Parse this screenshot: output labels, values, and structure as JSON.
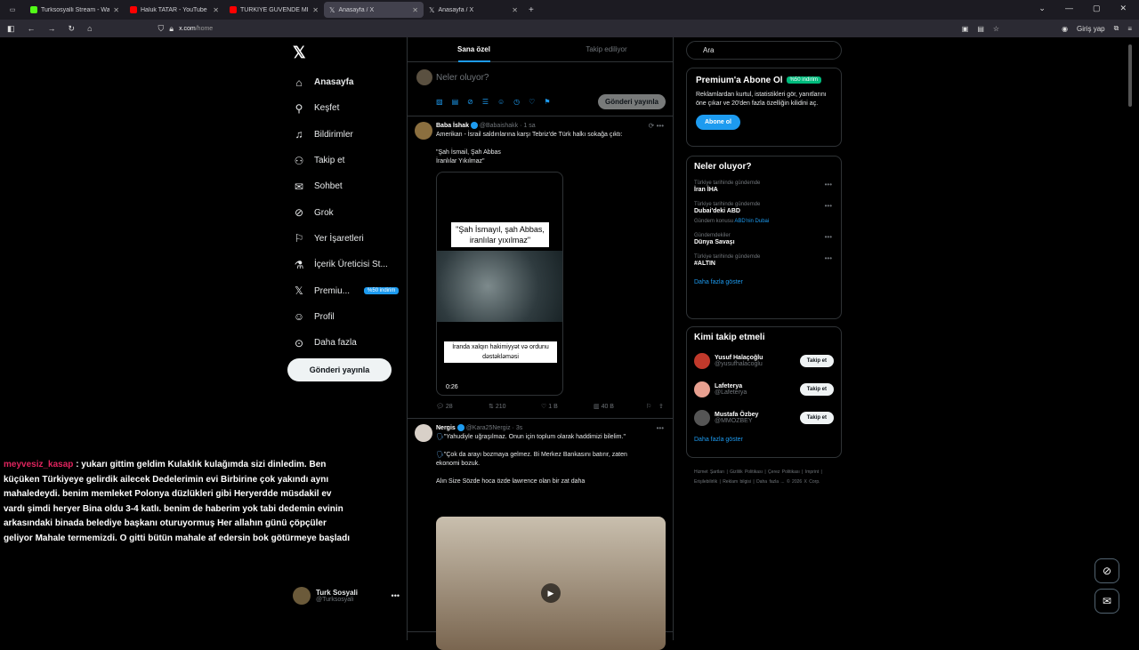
{
  "browser": {
    "tabs": [
      {
        "title": "Turksosyalli Stream - Watch",
        "color": "#53fc18",
        "active": false
      },
      {
        "title": "Haluk TATAR - YouTube",
        "color": "#ff0000",
        "active": false
      },
      {
        "title": "TÜRKİYE GÜVENDE Mİ? - 9",
        "color": "#ff0000",
        "active": false
      },
      {
        "title": "Anasayfa / X",
        "color": "#ffffff",
        "active": true
      },
      {
        "title": "Anasayfa / X",
        "color": "#ffffff",
        "active": false
      }
    ],
    "url_domain": "x.com",
    "url_path": "/home",
    "signin_label": "Giriş yap"
  },
  "nav": {
    "items": [
      {
        "label": "Anasayfa",
        "icon": "home-icon"
      },
      {
        "label": "Keşfet",
        "icon": "search-icon"
      },
      {
        "label": "Bildirimler",
        "icon": "bell-icon"
      },
      {
        "label": "Takip et",
        "icon": "person-add-icon"
      },
      {
        "label": "Sohbet",
        "icon": "mail-icon"
      },
      {
        "label": "Grok",
        "icon": "grok-icon"
      },
      {
        "label": "Yer İşaretleri",
        "icon": "bookmark-icon"
      },
      {
        "label": "İçerik Üreticisi St...",
        "icon": "flask-icon"
      },
      {
        "label": "Premiu...",
        "icon": "x-icon",
        "badge": "%50 indirim"
      },
      {
        "label": "Profil",
        "icon": "person-icon"
      },
      {
        "label": "Daha fazla",
        "icon": "more-icon"
      }
    ],
    "post_button": "Gönderi yayınla",
    "account": {
      "name": "Turk Sosyali",
      "handle": "@Turksosyali"
    }
  },
  "chat": {
    "user": "meyvesiz_kasap",
    "message": ": yukarı gittim geldim Kulaklık kulağımda sizi dinledim. Ben küçüken Türkiyeye gelirdik ailecek Dedelerimin evi Birbirine çok yakındı aynı mahaledeydi. benim memleket Polonya düzlükleri gibi Heryerdde müsdakil ev vardı şimdi heryer Bina oldu 3-4 katlı. benim de haberim yok tabi dedemin evinin arkasındaki binada belediye başkanı oturuyormuş Her allahın günü çöpçüler geliyor Mahale termemizdi. O gitti bütün mahale af edersin bok götürmeye başladı"
  },
  "feed": {
    "tabs": [
      "Sana özel",
      "Takip ediliyor"
    ],
    "compose_placeholder": "Neler oluyor?",
    "compose_button": "Gönderi yayınla",
    "tweets": [
      {
        "name": "Baba İshak",
        "handle": "@Babaishakk",
        "time": "1 sa",
        "text1": "Amerikan - İsrail saldırılarına karşı Tebriz'de Türk halkı sokağa çıktı:",
        "text2": "\"Şah İsmail, Şah Abbas",
        "text3": "İranlılar Yıkılmaz\"",
        "caption_top": "\"Şah İsmayıl, şah Abbas, iranlılar yıxılmaz\"",
        "caption_bottom": "İranda xalqın hakimiyyət və ordunu dəstəkləməsi",
        "duration": "0:26",
        "replies": "28",
        "reposts": "210",
        "likes": "1 B",
        "views": "40 B"
      },
      {
        "name": "Nergis",
        "handle": "@Kara25Nergiz",
        "time": "3s",
        "text1": "\"Yahudiyle uğraşılmaz. Onun için toplum olarak haddimizi bilelim.\"",
        "text2": "\"Çok da arayı bozmaya gelmez. Bi Merkez Bankasını batırır, zaten ekonomi bozuk.",
        "text3": "Alın Size Sözde hoca özde lawrence olan bir zat daha"
      }
    ]
  },
  "sidebar": {
    "search_placeholder": "Ara",
    "premium": {
      "title": "Premium'a Abone Ol",
      "tag": "%50 indirim",
      "text": "Reklamlardan kurtul, istatistikleri gör, yanıtlarını öne çıkar ve 20'den fazla özelliğin kilidini aç.",
      "button": "Abone ol"
    },
    "trends": {
      "title": "Neler oluyor?",
      "items": [
        {
          "context": "Türkiye tarihinde gündemde",
          "name": "İran İHA"
        },
        {
          "context": "Türkiye tarihinde gündemde",
          "name": "Dubai'deki ABD",
          "sub_prefix": "Gündem konusu",
          "sub_link": "ABD'nin Dubai"
        },
        {
          "context": "Gündemdekiler",
          "name": "Dünya Savaşı"
        },
        {
          "context": "Türkiye tarihinde gündemde",
          "name": "#ALTIN"
        }
      ],
      "show_more": "Daha fazla göster"
    },
    "who_to_follow": {
      "title": "Kimi takip etmeli",
      "items": [
        {
          "name": "Yusuf Halaçoğlu",
          "handle": "@yusufhalacoglu",
          "color": "#c0392b"
        },
        {
          "name": "Lafeterya",
          "handle": "@Lafeterya",
          "color": "#e8a090"
        },
        {
          "name": "Mustafa Özbey",
          "handle": "@MMOZBEY",
          "color": "#555555"
        }
      ],
      "button": "Takip et",
      "show_more": "Daha fazla göster"
    },
    "footer": "Hizmet Şartları | Gizlilik Politikası | Çerez Politikası | Imprint | Erişilebilirlik | Reklam bilgisi | Daha fazla ... © 2026 X Corp."
  }
}
